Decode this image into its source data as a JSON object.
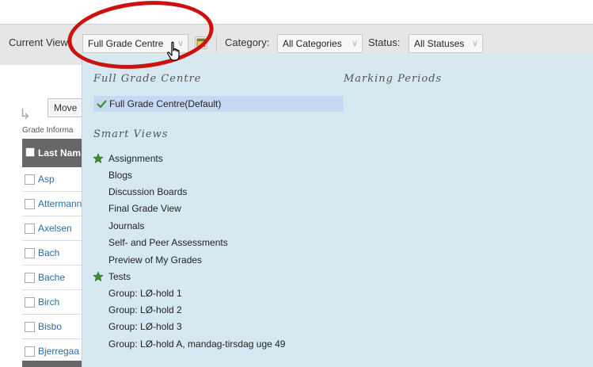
{
  "toolbar": {
    "current_view_label": "Current View:",
    "current_view_value": "Full Grade Centre",
    "category_label": "Category:",
    "category_value": "All Categories",
    "status_label": "Status:",
    "status_value": "All Statuses"
  },
  "grade_list": {
    "move_button_label": "Move",
    "grade_info_label": "Grade Informa",
    "last_name_header": "Last Nam",
    "rows": [
      "Asp",
      "Attermann",
      "Axelsen",
      "Bach",
      "Bache",
      "Birch",
      "Bisbo",
      "Bjerregaa"
    ]
  },
  "dropdown": {
    "full_grade_centre_heading": "Full Grade Centre",
    "marking_periods_heading": "Marking Periods",
    "default_item": "Full Grade Centre(Default)",
    "smart_views_heading": "Smart Views",
    "smart_views": [
      "Assignments",
      "Blogs",
      "Discussion Boards",
      "Final Grade View",
      "Journals",
      "Self- and Peer Assessments",
      "Preview of My Grades",
      "Tests",
      "Group: LØ-hold 1",
      "Group: LØ-hold 2",
      "Group: LØ-hold 3",
      "Group: LØ-hold A, mandag-tirsdag uge 49"
    ]
  },
  "colors": {
    "dropdown_bg": "#d6e9f0",
    "selected_bg": "#c5d9f2",
    "link": "#2e6ca6",
    "annotation": "#cc1111",
    "star": "#3a8f2c"
  }
}
